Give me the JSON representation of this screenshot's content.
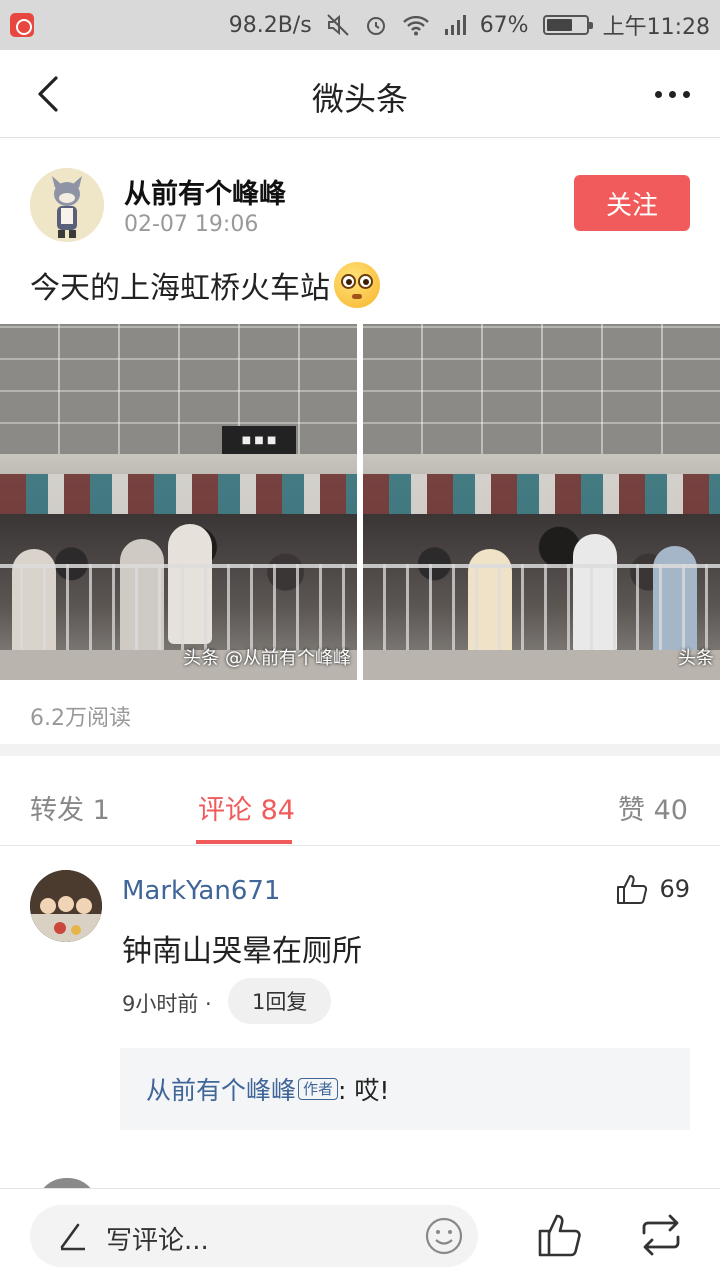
{
  "status_bar": {
    "speed": "98.2B/s",
    "battery": "67%",
    "battery_level": 0.67,
    "time": "上午11:28"
  },
  "nav": {
    "title": "微头条"
  },
  "post": {
    "author": "从前有个峰峰",
    "time": "02-07 19:06",
    "follow_label": "关注",
    "text": "今天的上海虹桥火车站",
    "photo_watermark": "头条 @从前有个峰峰",
    "photo2_watermark": "头条",
    "reads": "6.2万阅读"
  },
  "tabs": {
    "repost": "转发 1",
    "comments": "评论 84",
    "likes": "赞 40"
  },
  "comment": {
    "user": "MarkYan671",
    "likes": "69",
    "text": "钟南山哭晕在厕所",
    "time": "9小时前 ·",
    "reply_label": "1回复",
    "reply": {
      "author": "从前有个峰峰",
      "badge": "作者",
      "text": ": 哎!"
    }
  },
  "bottom_bar": {
    "placeholder": "写评论..."
  },
  "colors": {
    "accent": "#f15b5b",
    "link": "#406599"
  }
}
